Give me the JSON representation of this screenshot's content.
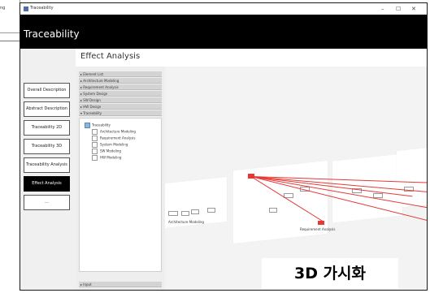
{
  "background_window": {
    "label": "ng"
  },
  "window": {
    "title": "Traceability",
    "minimize": "–",
    "maximize": "☐",
    "close": "✕"
  },
  "header": {
    "title": "Traceability"
  },
  "nav": {
    "items": [
      {
        "label": "Overall Description",
        "active": false
      },
      {
        "label": "Abstract Description",
        "active": false
      },
      {
        "label": "Traceability 2D",
        "active": false
      },
      {
        "label": "Traceability 3D",
        "active": false
      },
      {
        "label": "Traceability Analysis",
        "active": false
      },
      {
        "label": "Effect Analysis",
        "active": true
      },
      {
        "label": "...",
        "active": false
      }
    ]
  },
  "page": {
    "title": "Effect Analysis"
  },
  "accordion": {
    "sections": [
      "▸ Element List",
      "▸ Architecture Modeling",
      "▸ Requirement Analysis",
      "▸ System Design",
      "▸ SW Design",
      "▸ HW Design",
      "▾ Traceability"
    ],
    "bottom": "▸ Input"
  },
  "tree": {
    "root": "Traceability",
    "items": [
      "Architecture Modeling",
      "Requirement Analysis",
      "System Modeling",
      "SW Modeling",
      "HW Modeling"
    ]
  },
  "view": {
    "plane_labels": [
      "Architecture Modeling",
      "Requirement Analysis"
    ],
    "colors": {
      "link": "#e53935",
      "node": "#e53935"
    }
  },
  "caption": "3D 가시화"
}
